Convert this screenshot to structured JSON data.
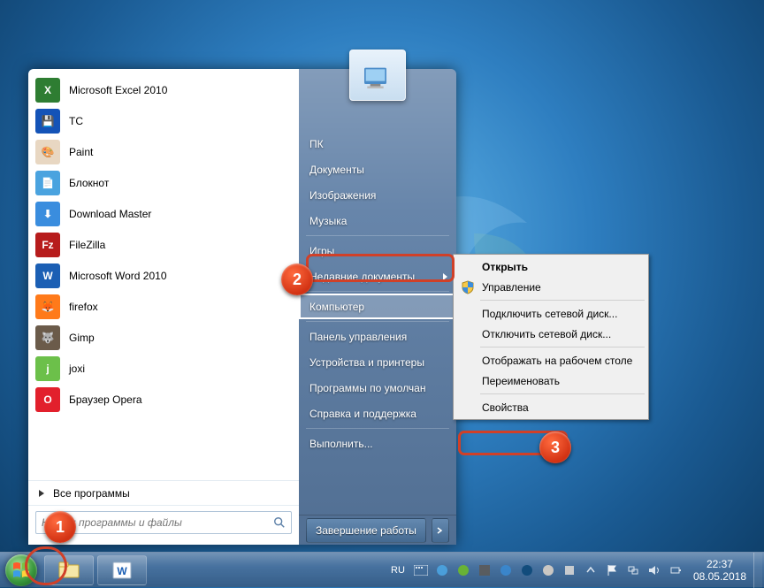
{
  "programs": [
    {
      "label": "Microsoft Excel 2010",
      "iconBg": "#2e7d32",
      "letter": "X"
    },
    {
      "label": "TC",
      "iconBg": "#1453b7",
      "letter": "💾"
    },
    {
      "label": "Paint",
      "iconBg": "#e8d7c2",
      "letter": "🎨"
    },
    {
      "label": "Блокнот",
      "iconBg": "#4aa3df",
      "letter": "📄"
    },
    {
      "label": "Download Master",
      "iconBg": "#3a8dde",
      "letter": "⬇"
    },
    {
      "label": "FileZilla",
      "iconBg": "#b71c1c",
      "letter": "Fz"
    },
    {
      "label": "Microsoft Word 2010",
      "iconBg": "#1b5fb4",
      "letter": "W"
    },
    {
      "label": "firefox",
      "iconBg": "#ff7a1a",
      "letter": "🦊"
    },
    {
      "label": "Gimp",
      "iconBg": "#6b5b4a",
      "letter": "🐺"
    },
    {
      "label": "joxi",
      "iconBg": "#6cc04a",
      "letter": "j"
    },
    {
      "label": "Браузер Opera",
      "iconBg": "#e2202c",
      "letter": "O"
    }
  ],
  "allPrograms": "Все программы",
  "searchPlaceholder": "Найти программы и файлы",
  "rightItems": [
    {
      "label": "ПК",
      "sep": false,
      "arrow": false,
      "hl": false
    },
    {
      "label": "Документы",
      "sep": false,
      "arrow": false,
      "hl": false
    },
    {
      "label": "Изображения",
      "sep": false,
      "arrow": false,
      "hl": false
    },
    {
      "label": "Музыка",
      "sep": false,
      "arrow": false,
      "hl": false
    },
    {
      "sep": true
    },
    {
      "label": "Игры",
      "sep": false,
      "arrow": false,
      "hl": false
    },
    {
      "label": "Недавние документы",
      "sep": false,
      "arrow": true,
      "hl": false
    },
    {
      "sep": true
    },
    {
      "label": "Компьютер",
      "sep": false,
      "arrow": false,
      "hl": true
    },
    {
      "sep": true
    },
    {
      "label": "Панель управления",
      "sep": false,
      "arrow": false,
      "hl": false
    },
    {
      "label": "Устройства и принтеры",
      "sep": false,
      "arrow": false,
      "hl": false
    },
    {
      "label": "Программы по умолчан",
      "sep": false,
      "arrow": false,
      "hl": false
    },
    {
      "label": "Справка и поддержка",
      "sep": false,
      "arrow": false,
      "hl": false
    },
    {
      "sep": true
    },
    {
      "label": "Выполнить...",
      "sep": false,
      "arrow": false,
      "hl": false
    }
  ],
  "shutdownLabel": "Завершение работы",
  "context": [
    {
      "label": "Открыть",
      "bold": true,
      "sep": false,
      "shield": false,
      "hl": false
    },
    {
      "label": "Управление",
      "bold": false,
      "sep": false,
      "shield": true,
      "hl": false
    },
    {
      "sep": true
    },
    {
      "label": "Подключить сетевой диск...",
      "bold": false,
      "sep": false,
      "shield": false,
      "hl": false
    },
    {
      "label": "Отключить сетевой диск...",
      "bold": false,
      "sep": false,
      "shield": false,
      "hl": false
    },
    {
      "sep": true
    },
    {
      "label": "Отображать на рабочем столе",
      "bold": false,
      "sep": false,
      "shield": false,
      "hl": false
    },
    {
      "label": "Переименовать",
      "bold": false,
      "sep": false,
      "shield": false,
      "hl": false
    },
    {
      "sep": true
    },
    {
      "label": "Свойства",
      "bold": false,
      "sep": false,
      "shield": false,
      "hl": true
    }
  ],
  "taskbar": {
    "lang": "RU",
    "time": "22:37",
    "date": "08.05.2018"
  },
  "callouts": {
    "c1": "1",
    "c2": "2",
    "c3": "3"
  }
}
